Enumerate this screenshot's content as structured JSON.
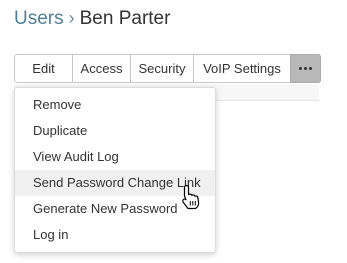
{
  "breadcrumb": {
    "parent": "Users",
    "separator": "›",
    "current": "Ben Parter"
  },
  "tabs": {
    "edit": "Edit",
    "access": "Access",
    "security": "Security",
    "voip": "VoIP Settings",
    "more_icon": "ellipsis-icon"
  },
  "menu": {
    "items": [
      "Remove",
      "Duplicate",
      "View Audit Log",
      "Send Password Change Link",
      "Generate New Password",
      "Log in"
    ],
    "hovered": "Send Password Change Link"
  },
  "cursor": "hand-pointer-icon",
  "colors": {
    "link": "#4f7f9b",
    "more_button": "#b9b9b9",
    "hover_row": "#f0f0f0"
  }
}
